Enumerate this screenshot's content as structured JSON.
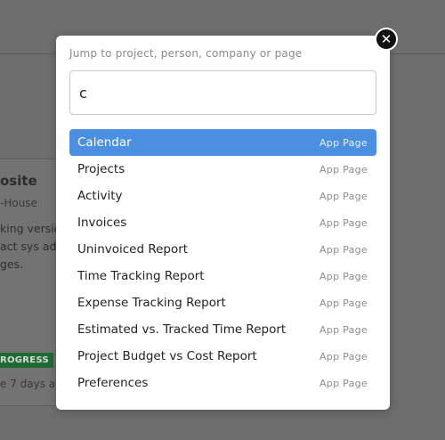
{
  "background": {
    "card_title": "osite",
    "card_subtitle": "-House",
    "card_desc_lines": [
      "king versio",
      "act sys ad",
      "ges."
    ],
    "badge": "ROGRESS",
    "timestamp": "e 7 days ago"
  },
  "modal": {
    "search_label": "Jump to project, person, company or page",
    "search_value": "c",
    "close_label": "✕",
    "results": [
      {
        "label": "Calendar",
        "type": "App Page",
        "selected": true
      },
      {
        "label": "Projects",
        "type": "App Page"
      },
      {
        "label": "Activity",
        "type": "App Page"
      },
      {
        "label": "Invoices",
        "type": "App Page"
      },
      {
        "label": "Uninvoiced Report",
        "type": "App Page"
      },
      {
        "label": "Time Tracking Report",
        "type": "App Page"
      },
      {
        "label": "Expense Tracking Report",
        "type": "App Page"
      },
      {
        "label": "Estimated vs. Tracked Time Report",
        "type": "App Page"
      },
      {
        "label": "Project Budget vs Cost Report",
        "type": "App Page"
      },
      {
        "label": "Preferences",
        "type": "App Page"
      }
    ]
  },
  "colors": {
    "selected_bg": "#4a8fe0",
    "overlay": "#6e6e6e"
  }
}
